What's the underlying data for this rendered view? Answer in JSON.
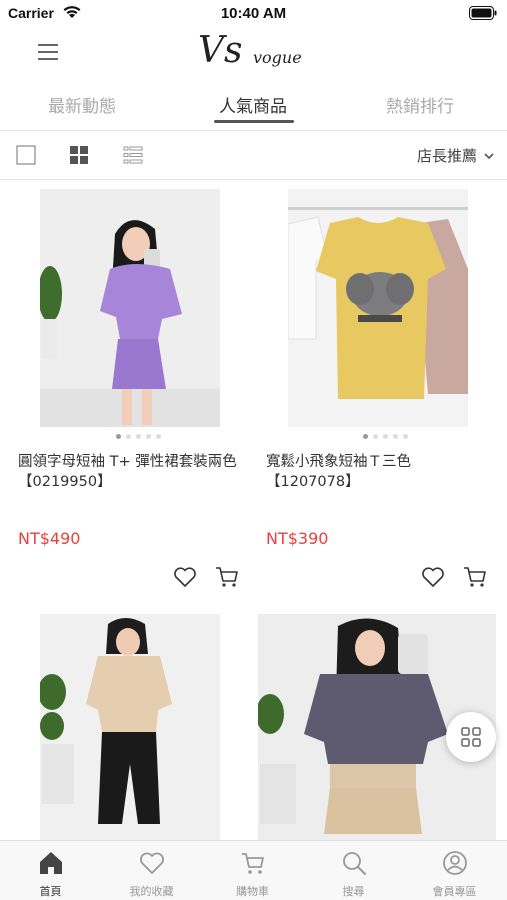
{
  "status_bar": {
    "carrier": "Carrier",
    "time": "10:40 AM"
  },
  "header": {
    "logo_main": "Vs",
    "logo_sub": "vogue"
  },
  "tabs": [
    {
      "label": "最新動態",
      "active": false
    },
    {
      "label": "人氣商品",
      "active": true
    },
    {
      "label": "熱銷排行",
      "active": false
    }
  ],
  "toolbar": {
    "sort_label": "店長推薦",
    "view_modes": [
      "single-view-icon",
      "grid-view-icon",
      "list-view-icon"
    ],
    "active_view": "grid-view-icon"
  },
  "products": [
    {
      "name": "圓領字母短袖 T+ 彈性裙套裝兩色【0219950】",
      "price": "NT$490",
      "image_slides": 5,
      "current_slide": 1
    },
    {
      "name": "寬鬆小飛象短袖Ｔ三色【1207078】",
      "price": "NT$390",
      "image_slides": 5,
      "current_slide": 1
    },
    {
      "name": "",
      "price": ""
    },
    {
      "name": "",
      "price": ""
    }
  ],
  "bottom_nav": [
    {
      "label": "首頁",
      "icon": "home-icon",
      "active": true
    },
    {
      "label": "我的收藏",
      "icon": "heart-icon",
      "active": false
    },
    {
      "label": "購物車",
      "icon": "cart-icon",
      "active": false
    },
    {
      "label": "搜尋",
      "icon": "search-icon",
      "active": false
    },
    {
      "label": "會員專區",
      "icon": "user-icon",
      "active": false
    }
  ],
  "colors": {
    "price": "#e8413e",
    "nav_active": "#333333",
    "nav_inactive": "#999999"
  }
}
